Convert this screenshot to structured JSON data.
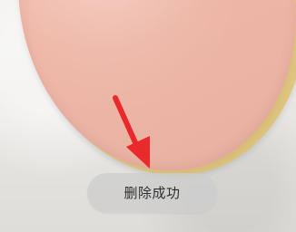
{
  "toast": {
    "message": "删除成功"
  }
}
